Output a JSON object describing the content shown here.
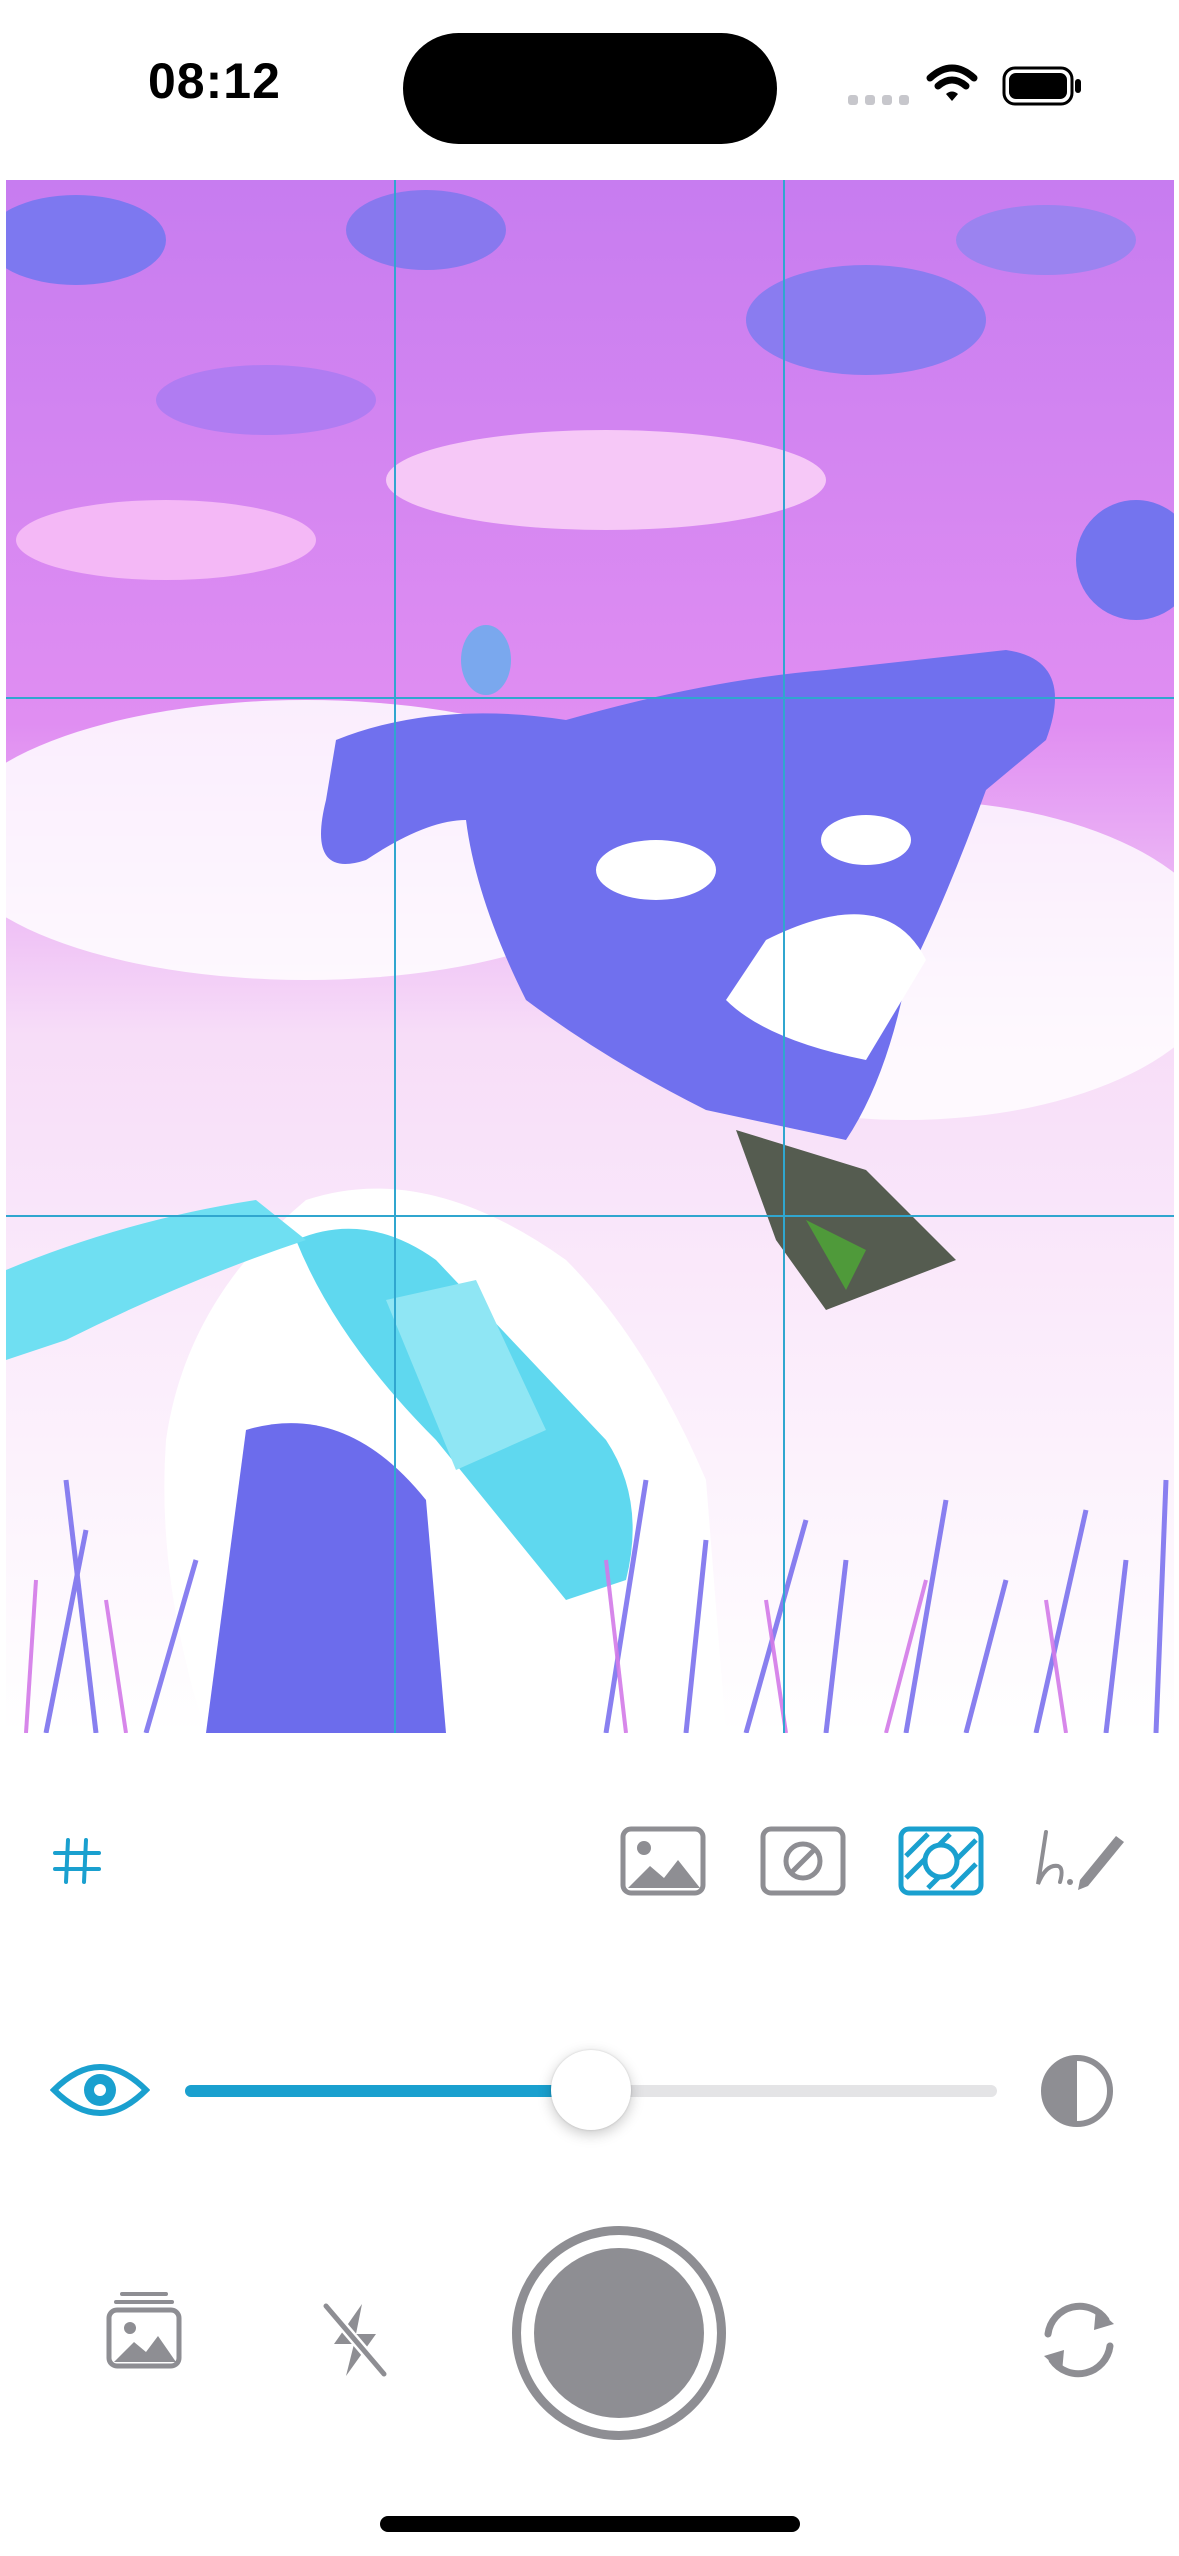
{
  "status_bar": {
    "time": "08:12",
    "icons": [
      "cellular-signal-icon",
      "wifi-icon",
      "battery-icon"
    ]
  },
  "viewfinder": {
    "grid_overlay": "3x3",
    "grid_color": "#30a6cf",
    "filter_palette": [
      "#7b74f0",
      "#d983f0",
      "#6fe6f3",
      "#ffffff"
    ]
  },
  "toolbar": {
    "left_icons": [
      "grid-icon"
    ],
    "right_icons": [
      "photo-overlay-icon",
      "opacity-mask-icon",
      "pattern-filter-icon",
      "draw-icon"
    ],
    "active_icon": "pattern-filter-icon",
    "active_color": "#1aa0cf",
    "inactive_color": "#8e8e93"
  },
  "opacity_slider": {
    "value": 0.5,
    "left_icon": "eye-icon",
    "right_icon": "contrast-icon"
  },
  "bottom_bar": {
    "icons": [
      "photo-library-icon",
      "flash-off-icon",
      "shutter-button",
      "switch-camera-icon"
    ]
  }
}
